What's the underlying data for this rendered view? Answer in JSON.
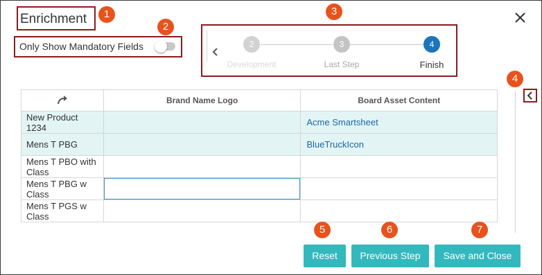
{
  "dialog": {
    "title": "Enrichment",
    "close_icon": "close-icon"
  },
  "toggle": {
    "label": "Only Show Mandatory Fields",
    "on": false
  },
  "steps": {
    "prev_icon": "chevron-left-icon",
    "items": [
      {
        "number": "2",
        "label": "Development",
        "state": "done"
      },
      {
        "number": "3",
        "label": "Last Step",
        "state": "done"
      },
      {
        "number": "4",
        "label": "Finish",
        "state": "current"
      }
    ]
  },
  "table": {
    "corner_icon": "redo-arrow-icon",
    "columns": [
      "Brand Name Logo",
      "Board Asset Content"
    ],
    "rows": [
      {
        "name": "New Product 1234",
        "brand_logo": "",
        "board_asset": "Acme Smartsheet",
        "highlight": true
      },
      {
        "name": "Mens T PBG",
        "brand_logo": "",
        "board_asset": "BlueTruckIcon",
        "highlight": true
      },
      {
        "name": "Mens T PBO with Class",
        "brand_logo": "",
        "board_asset": "",
        "highlight": false
      },
      {
        "name": "Mens T PBG w Class",
        "brand_logo": "",
        "board_asset": "",
        "highlight": false
      },
      {
        "name": "Mens T PGS w Class",
        "brand_logo": "",
        "board_asset": "",
        "highlight": false
      }
    ]
  },
  "side_panel": {
    "collapse_icon": "chevron-left-icon"
  },
  "buttons": {
    "reset": "Reset",
    "previous": "Previous Step",
    "save_close": "Save and Close"
  },
  "badges": [
    "1",
    "2",
    "3",
    "4",
    "5",
    "6",
    "7"
  ],
  "colors": {
    "accent": "#33b9bd",
    "step_active": "#1b75bb",
    "step_done": "#c9c9c9",
    "highlight_row": "#e3f4f4",
    "link": "#1768a8",
    "badge": "#e8521c",
    "callout_border": "#8b1c1c"
  }
}
